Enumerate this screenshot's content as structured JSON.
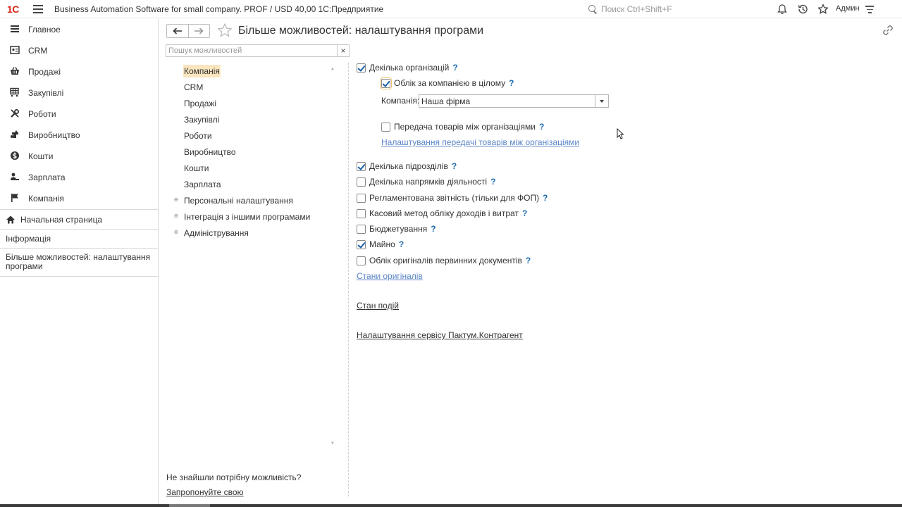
{
  "topbar": {
    "logo": "1C",
    "title": "Business Automation Software for small company. PROF / USD 40,00 1С:Предприятие",
    "search_placeholder": "Поиск Ctrl+Shift+F",
    "user": "Админ"
  },
  "sidebar": {
    "items": [
      {
        "label": "Главное",
        "icon": "menu-icon"
      },
      {
        "label": "CRM",
        "icon": "crm-icon"
      },
      {
        "label": "Продажі",
        "icon": "basket-icon"
      },
      {
        "label": "Закупівлі",
        "icon": "cart-icon"
      },
      {
        "label": "Роботи",
        "icon": "tools-icon"
      },
      {
        "label": "Виробництво",
        "icon": "factory-icon"
      },
      {
        "label": "Кошти",
        "icon": "money-icon"
      },
      {
        "label": "Зарплата",
        "icon": "people-icon"
      },
      {
        "label": "Компанія",
        "icon": "flag-icon"
      }
    ],
    "home": "Начальная страница",
    "info": "Інформація",
    "open_window": "Більше можливостей: налаштування програми"
  },
  "form": {
    "title": "Більше можливостей: налаштування програми",
    "search_placeholder": "Пошук можливостей",
    "clear": "×",
    "tree": [
      {
        "label": "Компанія",
        "selected": true,
        "expandable": false
      },
      {
        "label": "CRM",
        "selected": false,
        "expandable": false
      },
      {
        "label": "Продажі",
        "selected": false,
        "expandable": false
      },
      {
        "label": "Закупівлі",
        "selected": false,
        "expandable": false
      },
      {
        "label": "Роботи",
        "selected": false,
        "expandable": false
      },
      {
        "label": "Виробництво",
        "selected": false,
        "expandable": false
      },
      {
        "label": "Кошти",
        "selected": false,
        "expandable": false
      },
      {
        "label": "Зарплата",
        "selected": false,
        "expandable": false
      },
      {
        "label": "Персональні налаштування",
        "selected": false,
        "expandable": true
      },
      {
        "label": "Інтеграція з іншими програмами",
        "selected": false,
        "expandable": true
      },
      {
        "label": "Адміністрування",
        "selected": false,
        "expandable": true
      }
    ],
    "not_found": "Не знайшли потрібну можливість?",
    "propose": "Запропонуйте свою"
  },
  "settings": {
    "multi_org": {
      "label": "Декілька організацій",
      "checked": true
    },
    "company_accounting": {
      "label": "Облік за компанією в цілому",
      "checked": true
    },
    "company_label": "Компанія:",
    "company_value": "Наша фірма",
    "transfer_goods": {
      "label": "Передача товарів між організаціями",
      "checked": false
    },
    "transfer_link": "Налаштування передачі товарів між організаціями",
    "options": [
      {
        "label": "Декілька підрозділів",
        "checked": true
      },
      {
        "label": "Декілька напрямків діяльності",
        "checked": false
      },
      {
        "label": "Регламентована звітність (тільки для ФОП)",
        "checked": false
      },
      {
        "label": "Касовий метод обліку доходів і витрат",
        "checked": false
      },
      {
        "label": "Бюджетування",
        "checked": false
      },
      {
        "label": "Майно",
        "checked": true
      },
      {
        "label": "Облік оригіналів первинних документів",
        "checked": false
      }
    ],
    "originals_link": "Стани оригіналів",
    "events_link": "Стан подій",
    "paktum_link": "Налаштування сервісу Пактум.Контрагент",
    "help": "?"
  },
  "colors": {
    "accent": "#1f6db0",
    "selection": "#fbe5bf",
    "brand": "#d62718"
  }
}
